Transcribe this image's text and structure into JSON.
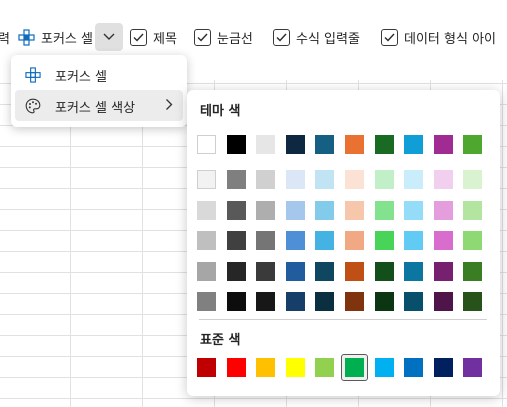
{
  "ribbon": {
    "partial_left_label": "력",
    "focus_cell_label": "포커스 셀",
    "checkboxes": [
      {
        "label": "제목",
        "checked": true
      },
      {
        "label": "눈금선",
        "checked": true
      },
      {
        "label": "수식 입력줄",
        "checked": true
      },
      {
        "label": "데이터 형식 아이",
        "checked": true
      }
    ]
  },
  "menu": {
    "items": [
      {
        "label": "포커스 셀",
        "icon": "focus-cell-icon"
      },
      {
        "label": "포커스 셀 색상",
        "icon": "palette-icon",
        "has_submenu": true
      }
    ]
  },
  "flyout": {
    "theme_title": "테마 색",
    "standard_title": "표준 색",
    "theme_top_row": [
      "#ffffff",
      "#000000",
      "#e7e6e6",
      "#0e2841",
      "#156082",
      "#e97132",
      "#196b24",
      "#0f9ed5",
      "#a02b93",
      "#4ea72e"
    ],
    "theme_shades": [
      [
        "#f2f2f2",
        "#7f7f7f",
        "#d0d0d0",
        "#dbe7f6",
        "#c1e4f5",
        "#fbe2d5",
        "#c1f0c8",
        "#caedfb",
        "#f2ceef",
        "#d9f2d0"
      ],
      [
        "#d9d9d9",
        "#595959",
        "#aeaeae",
        "#a5c7ec",
        "#83cbeb",
        "#f7c7ac",
        "#83e28e",
        "#95dcf8",
        "#e59edd",
        "#b3e5a1"
      ],
      [
        "#bfbfbf",
        "#404040",
        "#757575",
        "#4e8fd6",
        "#44b2e3",
        "#f1a983",
        "#47d459",
        "#61cbf3",
        "#d86dcd",
        "#8ed973"
      ],
      [
        "#a6a6a6",
        "#262626",
        "#3a3a3a",
        "#215d9e",
        "#0f4761",
        "#c04f15",
        "#124f1a",
        "#0b76a0",
        "#782070",
        "#3b7d23"
      ],
      [
        "#808080",
        "#0d0d0d",
        "#171717",
        "#163e69",
        "#0a2f41",
        "#7f340e",
        "#0c3511",
        "#074f6a",
        "#4f154b",
        "#275219"
      ]
    ],
    "standard_colors": [
      "#c00000",
      "#ff0000",
      "#ffc000",
      "#ffff00",
      "#92d050",
      "#00b050",
      "#00b0f0",
      "#0070c0",
      "#002060",
      "#7030a0"
    ],
    "selected_standard_index": 5
  }
}
